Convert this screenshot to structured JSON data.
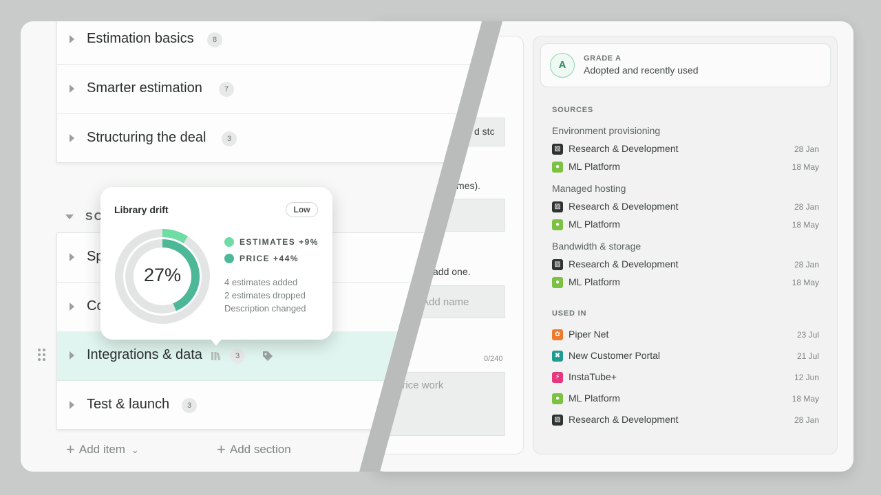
{
  "form": {
    "field_fragment": "d stc",
    "hint_fragment": "mes).",
    "add_one_fragment": "add one.",
    "add_name_placeholder": "Add name",
    "char_count": "0/240",
    "desc_fragment": "-price work"
  },
  "sidebar": {
    "grade": {
      "letter": "A",
      "title": "GRADE A",
      "description": "Adopted and recently used"
    },
    "sources_label": "SOURCES",
    "source_groups": [
      {
        "title": "Environment provisioning",
        "items": [
          {
            "name": "Research & Development",
            "date": "28 Jan",
            "icon": "rd-icon"
          },
          {
            "name": "ML Platform",
            "date": "18 May",
            "icon": "ml-icon"
          }
        ]
      },
      {
        "title": "Managed hosting",
        "items": [
          {
            "name": "Research & Development",
            "date": "28 Jan",
            "icon": "rd-icon"
          },
          {
            "name": "ML Platform",
            "date": "18 May",
            "icon": "ml-icon"
          }
        ]
      },
      {
        "title": "Bandwidth & storage",
        "items": [
          {
            "name": "Research & Development",
            "date": "28 Jan",
            "icon": "rd-icon"
          },
          {
            "name": "ML Platform",
            "date": "18 May",
            "icon": "ml-icon"
          }
        ]
      }
    ],
    "used_in_label": "USED IN",
    "used_in": [
      {
        "name": "Piper Net",
        "date": "23 Jul",
        "icon": "piper-net-icon"
      },
      {
        "name": "New Customer Portal",
        "date": "21 Jul",
        "icon": "customer-portal-icon"
      },
      {
        "name": "InstaTube+",
        "date": "12 Jun",
        "icon": "instatube-icon"
      },
      {
        "name": "ML Platform",
        "date": "18 May",
        "icon": "ml-icon"
      },
      {
        "name": "Research & Development",
        "date": "28 Jan",
        "icon": "rd-icon"
      }
    ]
  },
  "list": {
    "top_rows": [
      {
        "title": "Estimation basics",
        "count": "8"
      },
      {
        "title": "Smarter estimation",
        "count": "7"
      },
      {
        "title": "Structuring the deal",
        "count": "3"
      }
    ],
    "section_name": "SO",
    "section_rows": [
      {
        "title": "Sp"
      },
      {
        "title": "Co"
      },
      {
        "title": "Integrations & data",
        "count": "3"
      },
      {
        "title": "Test & launch",
        "count": "3"
      }
    ],
    "add_item": "Add item",
    "add_section": "Add section"
  },
  "popover": {
    "title": "Library drift",
    "badge": "Low",
    "percent": "27%",
    "percent_value": 27,
    "legend": [
      {
        "label": "ESTIMATES +9%",
        "color": "#6fdca4",
        "value": 9
      },
      {
        "label": "PRICE +44%",
        "color": "#4cb898",
        "value": 44
      }
    ],
    "changes": [
      "4 estimates added",
      "2 estimates dropped",
      "Description changed"
    ]
  }
}
